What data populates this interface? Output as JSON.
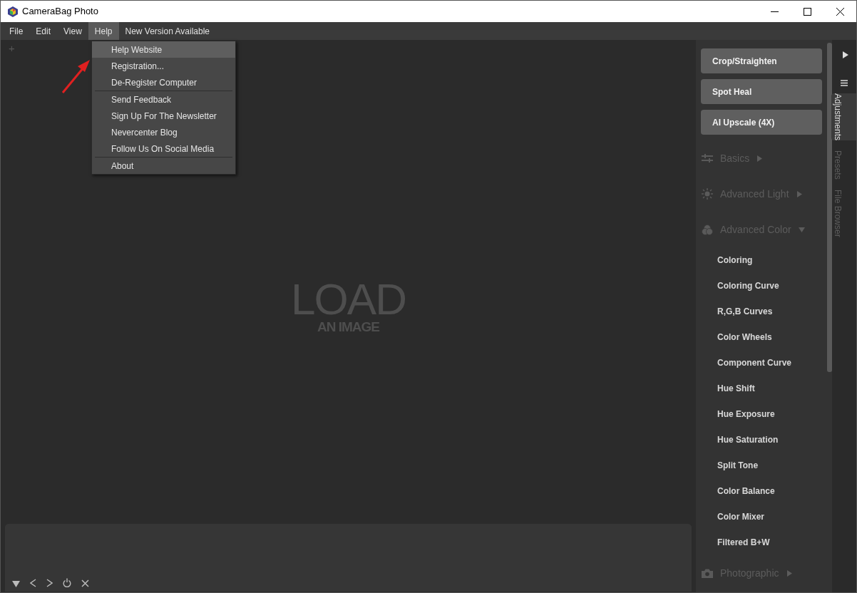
{
  "window": {
    "title": "CameraBag Photo"
  },
  "menu_bar": [
    {
      "label": "File",
      "selected": false
    },
    {
      "label": "Edit",
      "selected": false
    },
    {
      "label": "View",
      "selected": false
    },
    {
      "label": "Help",
      "selected": true
    },
    {
      "label": "New Version Available",
      "selected": false
    }
  ],
  "help_menu": {
    "groups": [
      [
        {
          "label": "Help Website",
          "highlighted": true
        },
        {
          "label": "Registration...",
          "highlighted": false
        },
        {
          "label": "De-Register Computer",
          "highlighted": false
        }
      ],
      [
        {
          "label": "Send Feedback",
          "highlighted": false
        },
        {
          "label": "Sign Up For The Newsletter",
          "highlighted": false
        },
        {
          "label": "Nevercenter Blog",
          "highlighted": false
        },
        {
          "label": "Follow Us On Social Media",
          "highlighted": false
        }
      ],
      [
        {
          "label": "About",
          "highlighted": false
        }
      ]
    ]
  },
  "canvas": {
    "add_tab": "+",
    "title": "LOAD",
    "subtitle": "AN IMAGE"
  },
  "adjustments": [
    {
      "kind": "button",
      "label": "Crop/Straighten"
    },
    {
      "kind": "button",
      "label": "Spot Heal"
    },
    {
      "kind": "button",
      "label": "AI Upscale (4X)"
    },
    {
      "kind": "section",
      "label": "Basics",
      "expanded": false
    },
    {
      "kind": "section",
      "label": "Advanced Light",
      "expanded": false
    },
    {
      "kind": "section",
      "label": "Advanced Color",
      "expanded": true
    },
    {
      "kind": "item",
      "label": "Coloring"
    },
    {
      "kind": "item",
      "label": "Coloring Curve"
    },
    {
      "kind": "item",
      "label": "R,G,B Curves"
    },
    {
      "kind": "item",
      "label": "Color Wheels"
    },
    {
      "kind": "item",
      "label": "Component Curve"
    },
    {
      "kind": "item",
      "label": "Hue Shift"
    },
    {
      "kind": "item",
      "label": "Hue Exposure"
    },
    {
      "kind": "item",
      "label": "Hue Saturation"
    },
    {
      "kind": "item",
      "label": "Split Tone"
    },
    {
      "kind": "item",
      "label": "Color Balance"
    },
    {
      "kind": "item",
      "label": "Color Mixer"
    },
    {
      "kind": "item",
      "label": "Filtered B+W"
    },
    {
      "kind": "section",
      "label": "Photographic",
      "expanded": false
    }
  ],
  "side_tabs": [
    {
      "label": "Adjustments",
      "selected": true
    },
    {
      "label": "Presets",
      "selected": false
    },
    {
      "label": "File Browser",
      "selected": false
    }
  ]
}
